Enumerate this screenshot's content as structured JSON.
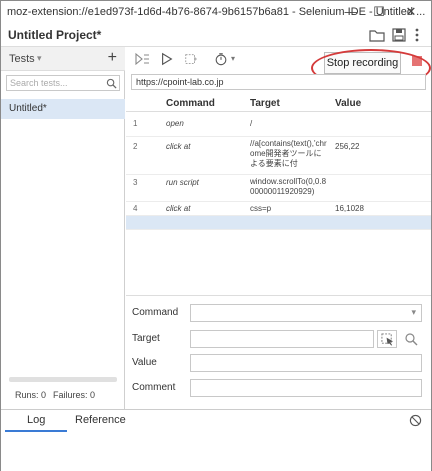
{
  "window": {
    "title": "moz-extension://e1ed973f-1d6d-4b76-8674-9b6157b6a81 - Selenium IDE - Untitled ...",
    "minimize_glyph": "—",
    "maximize_glyph": "☐",
    "close_glyph": "✕"
  },
  "project": {
    "title": "Untitled Project*"
  },
  "tests_panel": {
    "header_label": "Tests",
    "dropdown_glyph": "▾",
    "add_glyph": "+",
    "search_placeholder": "Search tests...",
    "items": [
      {
        "label": "Untitled*"
      }
    ],
    "runs_text": "Runs: 0",
    "failures_text": "Failures: 0",
    "progress": 0
  },
  "toolbar": {
    "stop_recording_label": "Stop recording",
    "record_color": "#e57373"
  },
  "url_bar": {
    "value": "https://cpoint-lab.co.jp"
  },
  "table": {
    "headers": {
      "command": "Command",
      "target": "Target",
      "value": "Value"
    },
    "rows": [
      {
        "num": "1",
        "command": "open",
        "target": "/",
        "value": ""
      },
      {
        "num": "2",
        "command": "click at",
        "target": "//a[contains(text(),'chrome開発者ツールによる要素に付",
        "value": "256,22"
      },
      {
        "num": "3",
        "command": "run script",
        "target": "window.scrollTo(0,0.800000011920929)",
        "value": ""
      },
      {
        "num": "4",
        "command": "click at",
        "target": "css=p",
        "value": "16,1028"
      }
    ]
  },
  "editor": {
    "command_label": "Command",
    "target_label": "Target",
    "value_label": "Value",
    "comment_label": "Comment",
    "command_value": "",
    "target_value": "",
    "value_value": "",
    "comment_value": ""
  },
  "bottom_tabs": {
    "log": "Log",
    "reference": "Reference"
  },
  "colors": {
    "selection": "#dbe7f5",
    "annotation_circle": "#d43a3a",
    "tab_underline": "#3a7bd5"
  }
}
